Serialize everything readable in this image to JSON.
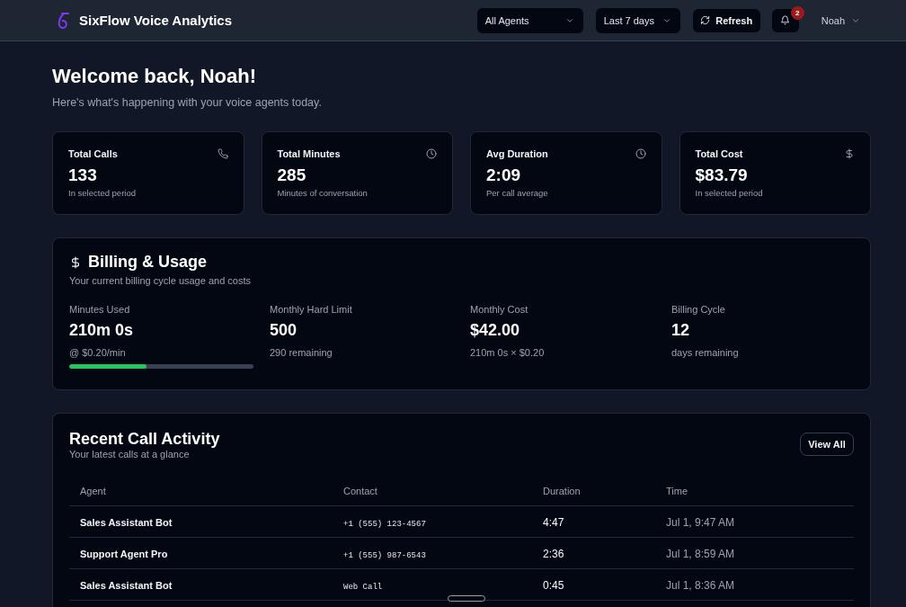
{
  "header": {
    "title": "SixFlow Voice Analytics",
    "agent_select": {
      "value": "All Agents"
    },
    "period_select": {
      "value": "Last 7 days"
    },
    "refresh_button": "Refresh",
    "notifications": {
      "count": "2"
    },
    "user_menu": "Noah"
  },
  "welcome": {
    "title": "Welcome back, Noah!",
    "subtitle": "Here's what's happening with your voice agents today."
  },
  "stats": [
    {
      "kind": "calls",
      "label": "Total Calls",
      "value": "133",
      "caption": "In selected period"
    },
    {
      "kind": "minutes",
      "label": "Total Minutes",
      "value": "285",
      "caption": "Minutes of conversation"
    },
    {
      "kind": "duration",
      "label": "Avg Duration",
      "value": "2:09",
      "caption": "Per call average"
    },
    {
      "kind": "cost",
      "label": "Total Cost",
      "value": "$83.79",
      "caption": "In selected period"
    }
  ],
  "billing": {
    "title": "Billing & Usage",
    "subtitle": "Your current billing cycle usage and costs",
    "metrics": [
      {
        "kind": "progress",
        "label": "Minutes Used",
        "value": "210m 0s",
        "caption": "@ $0.20/min",
        "level": 0.42
      },
      {
        "kind": "plain",
        "label": "Monthly Hard Limit",
        "value": "500",
        "caption": "290 remaining"
      },
      {
        "kind": "plain",
        "label": "Monthly Cost",
        "value": "$42.00",
        "caption": "210m 0s × $0.20"
      },
      {
        "kind": "plain",
        "label": "Billing Cycle",
        "value": "12",
        "caption": "days remaining"
      }
    ]
  },
  "recent_calls": {
    "title": "Recent Call Activity",
    "subtitle": "Your latest calls at a glance",
    "view_all_button": "View All",
    "table": {
      "columns": [
        "Agent",
        "Contact",
        "Duration",
        "Time"
      ],
      "rows": [
        {
          "agent": "Sales Assistant Bot",
          "contact": "+1 (555) 123-4567",
          "duration": "4:47",
          "time": "Jul 1, 9:47 AM"
        },
        {
          "agent": "Support Agent Pro",
          "contact": "+1 (555) 987-6543",
          "duration": "2:36",
          "time": "Jul 1, 8:59 AM"
        },
        {
          "agent": "Sales Assistant Bot",
          "contact": "Web Call",
          "duration": "0:45",
          "time": "Jul 1, 8:36 AM"
        }
      ]
    }
  }
}
